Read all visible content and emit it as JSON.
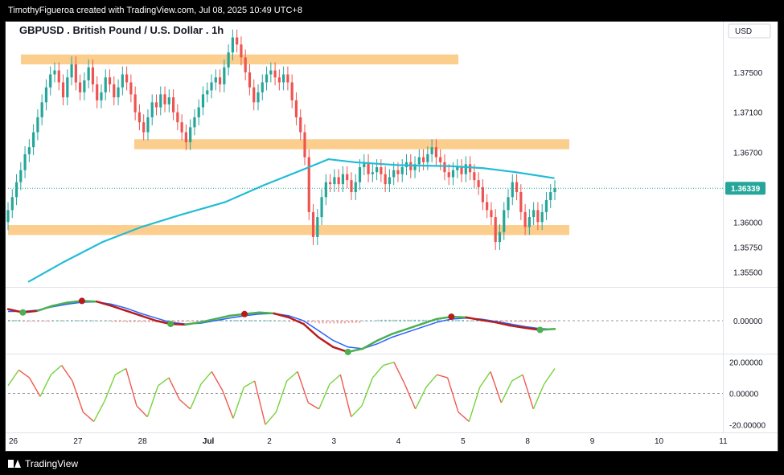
{
  "header": {
    "credit": "TimothyFigueroa created with TradingView.com, Jul 08, 2025 10:49 UTC+8"
  },
  "footer": {
    "brand": "TradingView"
  },
  "colors": {
    "up": "#26a69a",
    "down": "#ef5350",
    "ma": "#22bcd6",
    "zone": "#fbc679",
    "macd": "#2962ff",
    "signal_up": "#4caf50",
    "signal_down": "#b71c1c",
    "rsi_up": "#76d33b",
    "rsi_down": "#f05a4f"
  },
  "chart_data": [
    {
      "type": "candlestick",
      "title": "GBPUSD . British Pound / U.S. Dollar . 1h",
      "currency": "USD",
      "last_price": "1.36339",
      "ylim": [
        1.3535,
        1.38
      ],
      "y_ticks": [
        "1.37500",
        "1.37100",
        "1.36700",
        "1.36300",
        "1.36000",
        "1.35750",
        "1.35500"
      ],
      "x_ticks": [
        "26",
        "27",
        "28",
        "Jul",
        "2",
        "3",
        "4",
        "5",
        "8",
        "9",
        "10",
        "11"
      ],
      "zones": [
        {
          "from": 1.3758,
          "to": 1.3768
        },
        {
          "from": 1.3673,
          "to": 1.3683
        },
        {
          "from": 1.3587,
          "to": 1.3597
        }
      ],
      "moving_average": [
        {
          "x": 26.25,
          "y": 1.354
        },
        {
          "x": 26.8,
          "y": 1.356
        },
        {
          "x": 27.4,
          "y": 1.358
        },
        {
          "x": 28.0,
          "y": 1.3595
        },
        {
          "x": 28.6,
          "y": 1.3607
        },
        {
          "x": 29.3,
          "y": 1.362
        },
        {
          "x": 29.9,
          "y": 1.3637
        },
        {
          "x": 30.6,
          "y": 1.3655
        },
        {
          "x": 30.9,
          "y": 1.3663
        },
        {
          "x": 31.3,
          "y": 1.366
        },
        {
          "x": 32.0,
          "y": 1.3657
        },
        {
          "x": 32.8,
          "y": 1.3656
        },
        {
          "x": 33.3,
          "y": 1.3654
        },
        {
          "x": 33.8,
          "y": 1.365
        },
        {
          "x": 34.4,
          "y": 1.3644
        }
      ],
      "candles_close": [
        1.3612,
        1.3625,
        1.364,
        1.3652,
        1.3668,
        1.3675,
        1.369,
        1.3705,
        1.372,
        1.3735,
        1.3748,
        1.3752,
        1.374,
        1.3725,
        1.3745,
        1.3758,
        1.374,
        1.373,
        1.3742,
        1.3755,
        1.3738,
        1.3722,
        1.373,
        1.3745,
        1.3738,
        1.3725,
        1.3735,
        1.3748,
        1.374,
        1.3728,
        1.371,
        1.37,
        1.369,
        1.3705,
        1.372,
        1.3715,
        1.3728,
        1.3718,
        1.3725,
        1.371,
        1.37,
        1.369,
        1.368,
        1.3695,
        1.3705,
        1.3715,
        1.3728,
        1.3732,
        1.374,
        1.3745,
        1.3738,
        1.3755,
        1.377,
        1.3785,
        1.3778,
        1.3765,
        1.375,
        1.3735,
        1.372,
        1.373,
        1.374,
        1.3748,
        1.3752,
        1.3745,
        1.374,
        1.3748,
        1.374,
        1.3722,
        1.3705,
        1.369,
        1.3665,
        1.361,
        1.3585,
        1.3605,
        1.3625,
        1.364,
        1.3638,
        1.3645,
        1.3638,
        1.3648,
        1.3642,
        1.363,
        1.364,
        1.3655,
        1.366,
        1.3648,
        1.365,
        1.3655,
        1.3648,
        1.3638,
        1.3645,
        1.3652,
        1.3648,
        1.3655,
        1.366,
        1.3652,
        1.3658,
        1.3665,
        1.366,
        1.3668,
        1.3675,
        1.3665,
        1.366,
        1.365,
        1.3645,
        1.3652,
        1.3655,
        1.3648,
        1.3658,
        1.365,
        1.3642,
        1.3635,
        1.362,
        1.3612,
        1.3605,
        1.358,
        1.359,
        1.3612,
        1.3625,
        1.364,
        1.363,
        1.361,
        1.3595,
        1.3605,
        1.3612,
        1.36,
        1.361,
        1.3622,
        1.363,
        1.3634
      ]
    },
    {
      "type": "line",
      "title": "",
      "ylim": [
        -1,
        1
      ],
      "y_ticks": [
        "0.00000"
      ],
      "series": [
        {
          "values": [
            0.35,
            0.25,
            0.3,
            0.45,
            0.55,
            0.6,
            0.58,
            0.45,
            0.3,
            0.15,
            0.0,
            -0.1,
            -0.12,
            -0.05,
            0.05,
            0.15,
            0.2,
            0.25,
            0.22,
            0.1,
            -0.1,
            -0.5,
            -0.8,
            -0.95,
            -0.85,
            -0.6,
            -0.4,
            -0.25,
            -0.1,
            0.05,
            0.12,
            0.1,
            0.02,
            -0.05,
            -0.15,
            -0.22,
            -0.28,
            -0.25
          ]
        },
        {
          "values": [
            0.28,
            0.28,
            0.32,
            0.42,
            0.5,
            0.56,
            0.57,
            0.5,
            0.38,
            0.22,
            0.08,
            -0.05,
            -0.1,
            -0.08,
            0.0,
            0.08,
            0.15,
            0.2,
            0.22,
            0.15,
            0.0,
            -0.3,
            -0.6,
            -0.8,
            -0.85,
            -0.7,
            -0.5,
            -0.35,
            -0.2,
            -0.05,
            0.05,
            0.08,
            0.05,
            -0.02,
            -0.1,
            -0.18,
            -0.24,
            -0.26
          ]
        }
      ]
    },
    {
      "type": "line",
      "title": "",
      "ylim": [
        -25,
        25
      ],
      "y_ticks": [
        "20.00000",
        "0.00000",
        "-20.00000"
      ],
      "series": [
        {
          "values": [
            5,
            15,
            10,
            -2,
            12,
            18,
            8,
            -12,
            -18,
            -5,
            12,
            16,
            -8,
            -15,
            5,
            10,
            -4,
            -10,
            6,
            14,
            2,
            -16,
            4,
            8,
            -20,
            -12,
            8,
            14,
            -6,
            -10,
            6,
            12,
            -15,
            -8,
            10,
            18,
            20,
            6,
            -10,
            4,
            12,
            10,
            -12,
            -18,
            4,
            14,
            -6,
            8,
            12,
            -10,
            6,
            16
          ]
        }
      ]
    }
  ]
}
